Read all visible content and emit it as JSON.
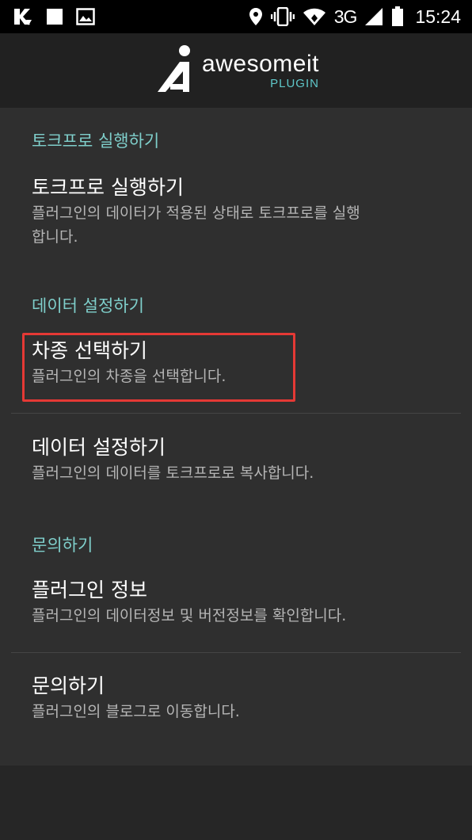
{
  "status_bar": {
    "time": "15:24",
    "network": "3G",
    "icons": [
      "app-notification-icon",
      "square-notification-icon",
      "image-notification-icon",
      "location-icon",
      "vibrate-icon",
      "wifi-icon",
      "signal-icon",
      "battery-icon"
    ]
  },
  "header": {
    "logo_name": "awesomeit",
    "logo_sub": "PLUGIN"
  },
  "sections": [
    {
      "category": "토크프로 실행하기",
      "items": [
        {
          "title": "토크프로 실행하기",
          "summary": "플러그인의 데이터가 적용된 상태로 토크프로를 실행",
          "summary2": "합니다."
        }
      ]
    },
    {
      "category": "데이터 설정하기",
      "items": [
        {
          "title": "차종 선택하기",
          "summary": "플러그인의 차종을 선택합니다."
        },
        {
          "title": "데이터 설정하기",
          "summary": "플러그인의 데이터를 토크프로로 복사합니다."
        }
      ]
    },
    {
      "category": "문의하기",
      "items": [
        {
          "title": "플러그인 정보",
          "summary": "플러그인의 데이터정보 및 버전정보를 확인합니다."
        },
        {
          "title": "문의하기",
          "summary": "플러그인의 블로그로 이동합니다."
        }
      ]
    }
  ],
  "colors": {
    "accent": "#7fcfcb",
    "highlight": "#e53935",
    "background": "#2f2f2f"
  }
}
